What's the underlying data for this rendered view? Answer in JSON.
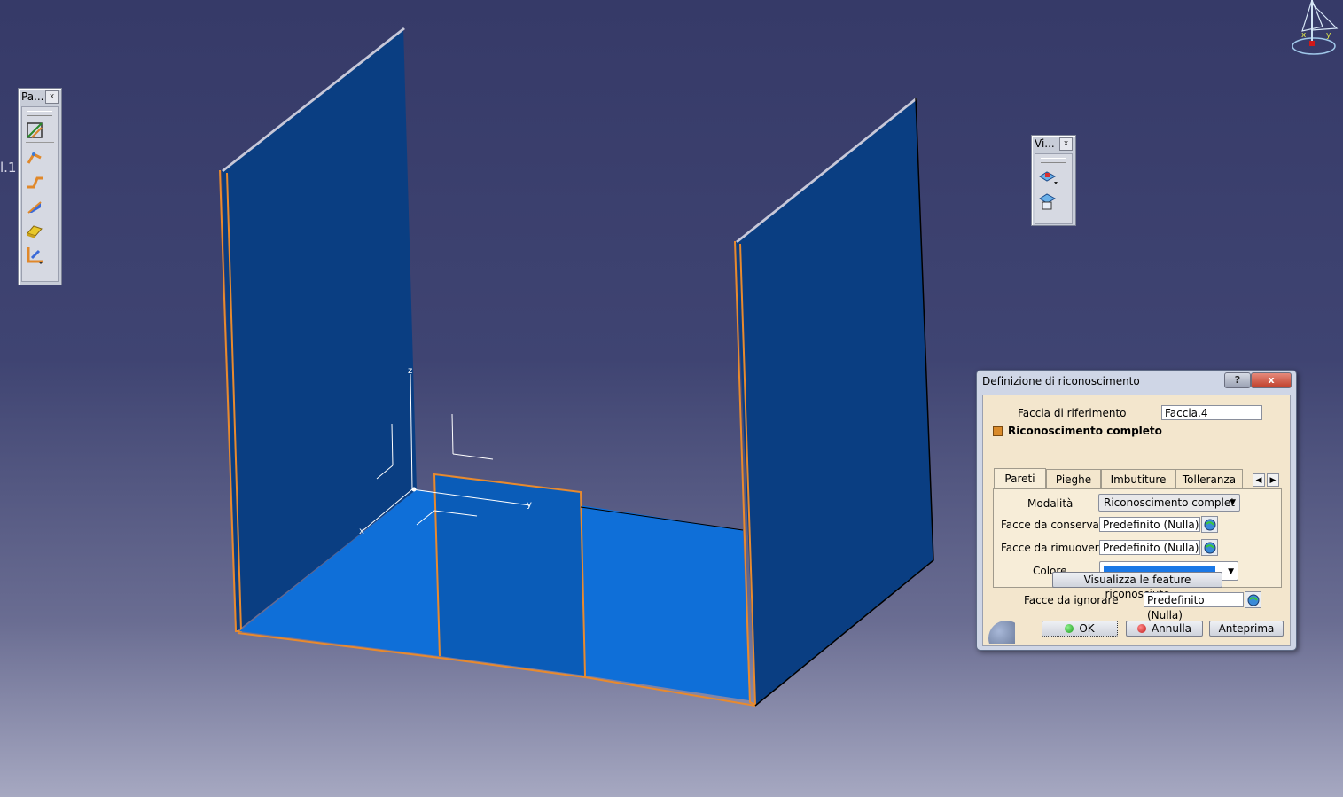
{
  "viewport": {
    "partial_label": "l.1",
    "axis_labels": {
      "x": "x",
      "y": "y",
      "z": "z"
    },
    "colors": {
      "wall_face": "#0a3e82",
      "floor_face": "#0f6fd8",
      "edge_highlight": "#e88a2e",
      "top_edge": "#c8c8d8"
    }
  },
  "compass": {
    "x_label": "x",
    "y_label": "y"
  },
  "toolbar_left": {
    "title": "Pa...",
    "close": "x",
    "icons": [
      "recognize-features-icon",
      "walls-icon",
      "bend-icon",
      "flange-icon",
      "stamp-icon",
      "corner-relief-icon"
    ]
  },
  "toolbar_right": {
    "title": "Vi...",
    "close": "x",
    "icons": [
      "views-icon",
      "view-manager-icon"
    ]
  },
  "dialog": {
    "title": "Definizione di riconoscimento",
    "help_label": "?",
    "close_label": "x",
    "reference_face_label": "Faccia di riferimento",
    "reference_face_value": "Faccia.4",
    "full_recognition_label": "Riconoscimento completo",
    "tabs": [
      "Pareti",
      "Pieghe",
      "Imbutiture",
      "Tolleranza di"
    ],
    "active_tab": "Pareti",
    "modality_label": "Modalità",
    "modality_value": "Riconoscimento complet",
    "faces_keep_label": "Facce da conservare",
    "faces_keep_value": "Predefinito (Nulla)",
    "faces_remove_label": "Facce da rimuovere",
    "faces_remove_value": "Predefinito (Nulla)",
    "color_label": "Colore",
    "color_value": "#1a78e6",
    "show_features_label": "Visualizza le feature riconosciute",
    "faces_ignore_label": "Facce da ignorare",
    "faces_ignore_value": "Predefinito (Nulla)",
    "ok_label": "OK",
    "cancel_label": "Annulla",
    "preview_label": "Anteprima"
  }
}
